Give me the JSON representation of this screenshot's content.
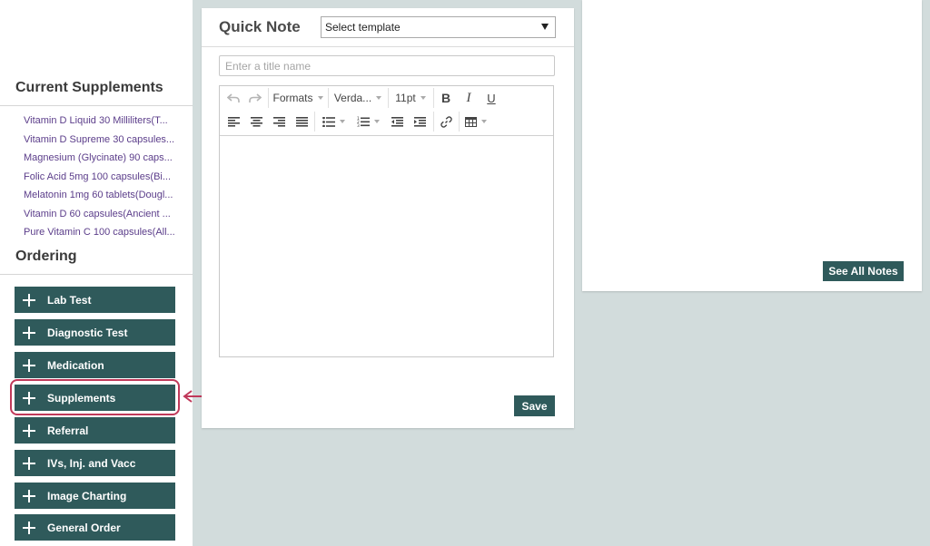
{
  "sidebar": {
    "current_supplements_title": "Current Supplements",
    "supplements": [
      "Vitamin D Liquid 30 Milliliters(T...",
      "Vitamin D Supreme 30 capsules...",
      "Magnesium (Glycinate) 90 caps...",
      "Folic Acid 5mg 100 capsules(Bi...",
      "Melatonin 1mg 60 tablets(Dougl...",
      "Vitamin D 60 capsules(Ancient ...",
      "Pure Vitamin C 100 capsules(All..."
    ],
    "ordering_title": "Ordering",
    "ordering_buttons": [
      "Lab Test",
      "Diagnostic Test",
      "Medication",
      "Supplements",
      "Referral",
      "IVs, Inj. and Vacc",
      "Image Charting",
      "General Order"
    ],
    "highlighted_button": "Supplements"
  },
  "quick_note": {
    "title": "Quick Note",
    "template_select_value": "Select template",
    "title_input_placeholder": "Enter a title name",
    "toolbar": {
      "formats_label": "Formats",
      "font_family_label": "Verda...",
      "font_size_label": "11pt",
      "bold_label": "B",
      "italic_label": "I",
      "underline_label": "U"
    },
    "save_label": "Save"
  },
  "notes_panel": {
    "see_all_label": "See All Notes"
  },
  "colors": {
    "button_bg": "#2f5a5b",
    "link_text": "#5b3d8a",
    "highlight": "#c0395a",
    "background": "#d2dcdc"
  }
}
